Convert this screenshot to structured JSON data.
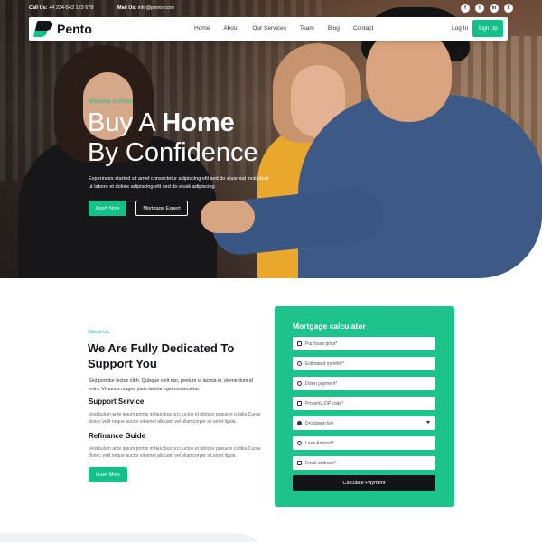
{
  "topbar": {
    "call_label": "Call Us:",
    "call_value": "+4 234-543 123 678",
    "mail_label": "Mail Us:",
    "mail_value": "info@pento.com",
    "socials": [
      "f",
      "t",
      "in",
      "li"
    ]
  },
  "navbar": {
    "logo_text": "Pento",
    "items": [
      "Home",
      "About",
      "Our Services",
      "Team",
      "Blog",
      "Contact"
    ],
    "login": "Log In",
    "signup": "Sign Up"
  },
  "hero": {
    "eyebrow": "Welcome to Pento",
    "title_line1_prefix": "Buy A ",
    "title_line1_bold": "Home",
    "title_line2": "By Confidence",
    "description": "Experinces started sit amet consectetur adipiscing elit sed do eiusmod incididunt ut labore et dolore adipiscing elit sed do eiusk adipiscing",
    "apply_button": "Apply Now",
    "expert_button": "Mortgage Expert"
  },
  "about": {
    "eyebrow": "About Us",
    "title": "We Are Fully Dedicated To Support You",
    "description": "Sed porttitor lectus nibh. Quisque velit nisi, pretium ut lacinia in, elementum id enim. Vivamus magna justo lacinia eget consectetur.",
    "sections": [
      {
        "title": "Support Service",
        "text": "Vestibulum ante ipsum primis in faucibus orci luctus et ultrices posuere cubilia Curae donec velit neque auctor sit amet aliquam vel ullamcorper sit amet ligula."
      },
      {
        "title": "Refinance Guide",
        "text": "Vestibulum ante ipsum primis in faucibus orci luctus et ultrices posuere cubilia Curae donec velit neque auctor sit amet aliquam vel ullamcorper sit amet ligula."
      }
    ],
    "learn_button": "Learn More"
  },
  "calculator": {
    "title": "Mortgage calculator",
    "fields": [
      {
        "placeholder": "Purchase price*",
        "icon": "home-icon"
      },
      {
        "placeholder": "Estimated monthly*",
        "icon": "dollar-icon"
      },
      {
        "placeholder": "Down payment*",
        "icon": "down-payment-icon"
      },
      {
        "placeholder": "Property ZIP code*",
        "icon": "location-icon"
      },
      {
        "placeholder": "Dropdown link",
        "icon": "check-circle-icon"
      },
      {
        "placeholder": "Loan Amount*",
        "icon": "dollar-icon"
      },
      {
        "placeholder": "Email address*",
        "icon": "mail-icon"
      }
    ],
    "button": "Calculate Payment"
  },
  "colors": {
    "accent": "#12c188",
    "card": "#1cc38a",
    "dark": "#111418"
  }
}
